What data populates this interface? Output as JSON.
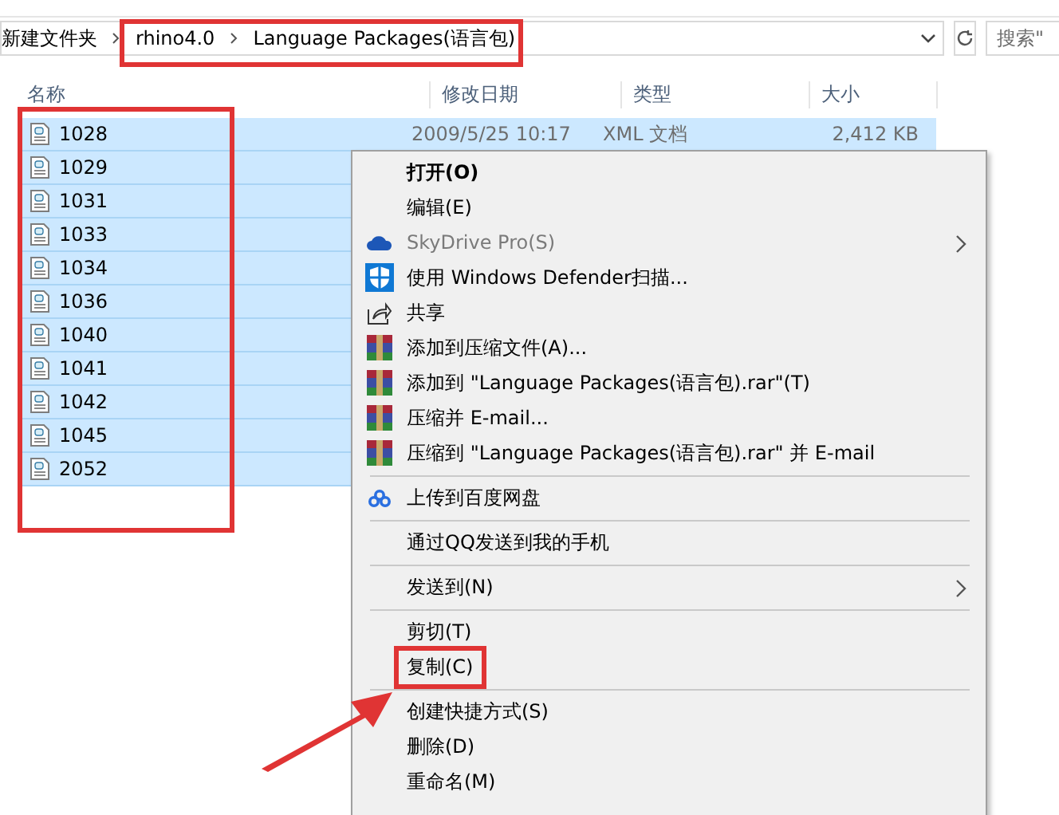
{
  "address_bar": {
    "breadcrumbs": [
      "新建文件夹",
      "rhino4.0",
      "Language Packages(语言包)"
    ]
  },
  "search": {
    "placeholder": "搜索\""
  },
  "columns": [
    "名称",
    "修改日期",
    "类型",
    "大小"
  ],
  "files": [
    {
      "name": "1028",
      "date": "2009/5/25 10:17",
      "type": "XML 文档",
      "size": "2,412 KB",
      "selected": true
    },
    {
      "name": "1029",
      "selected": true
    },
    {
      "name": "1031",
      "selected": true
    },
    {
      "name": "1033",
      "selected": true
    },
    {
      "name": "1034",
      "selected": true
    },
    {
      "name": "1036",
      "selected": true
    },
    {
      "name": "1040",
      "selected": true
    },
    {
      "name": "1041",
      "selected": true
    },
    {
      "name": "1042",
      "selected": true
    },
    {
      "name": "1045",
      "selected": true
    },
    {
      "name": "2052",
      "selected": true
    }
  ],
  "context_menu": [
    {
      "kind": "item",
      "label": "打开(O)",
      "bold": true
    },
    {
      "kind": "item",
      "label": "编辑(E)"
    },
    {
      "kind": "item",
      "label": "SkyDrive Pro(S)",
      "disabled": true,
      "submenu": true
    },
    {
      "kind": "item",
      "label": "使用 Windows Defender扫描..."
    },
    {
      "kind": "item",
      "label": "共享"
    },
    {
      "kind": "item",
      "label": "添加到压缩文件(A)..."
    },
    {
      "kind": "item",
      "label": "添加到 \"Language Packages(语言包).rar\"(T)"
    },
    {
      "kind": "item",
      "label": "压缩并 E-mail..."
    },
    {
      "kind": "item",
      "label": "压缩到 \"Language Packages(语言包).rar\" 并 E-mail"
    },
    {
      "kind": "separator"
    },
    {
      "kind": "item",
      "label": "上传到百度网盘"
    },
    {
      "kind": "separator"
    },
    {
      "kind": "item",
      "label": "通过QQ发送到我的手机"
    },
    {
      "kind": "separator"
    },
    {
      "kind": "item",
      "label": "发送到(N)",
      "submenu": true
    },
    {
      "kind": "separator"
    },
    {
      "kind": "item",
      "label": "剪切(T)"
    },
    {
      "kind": "item",
      "label": "复制(C)",
      "highlighted": true
    },
    {
      "kind": "separator"
    },
    {
      "kind": "item",
      "label": "创建快捷方式(S)"
    },
    {
      "kind": "item",
      "label": "删除(D)"
    },
    {
      "kind": "item",
      "label": "重命名(M)"
    }
  ]
}
